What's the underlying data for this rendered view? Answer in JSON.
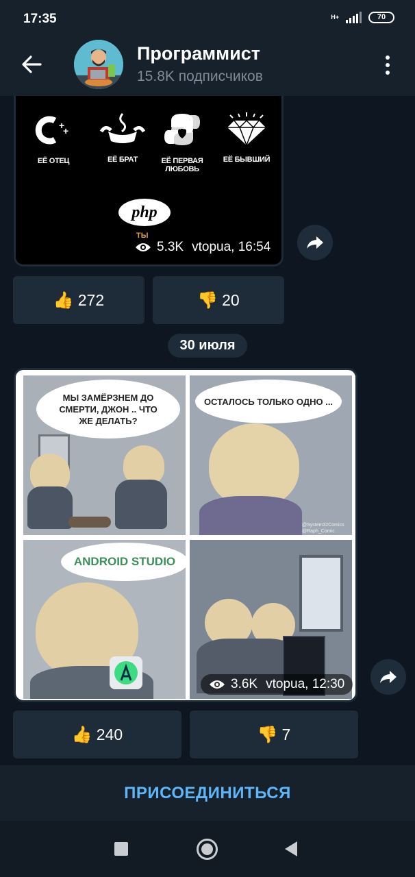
{
  "status_bar": {
    "time": "17:35",
    "network": "H+",
    "battery": "70"
  },
  "header": {
    "title": "Программист",
    "subtitle": "15.8K подписчиков"
  },
  "post1": {
    "languages": [
      {
        "icon": "cplusplus-icon",
        "label": "ЕЁ ОТЕЦ"
      },
      {
        "icon": "java-icon",
        "label": "ЕЁ БРАТ"
      },
      {
        "icon": "python-icon",
        "label": "ЕЁ ПЕРВАЯ ЛЮБОВЬ"
      },
      {
        "icon": "diamond-icon",
        "label": "ЕЁ БЫВШИЙ"
      }
    ],
    "php_logo": "php",
    "tag": "ТЫ",
    "views": "5.3K",
    "author_time": "vtopua, 16:54",
    "reactions": {
      "like": {
        "emoji": "👍",
        "count": "272"
      },
      "dislike": {
        "emoji": "👎",
        "count": "20"
      }
    }
  },
  "date_separator": "30 июля",
  "post2": {
    "bubble1": "МЫ ЗАМЁРЗНЕМ ДО СМЕРТИ, ДЖОН .. ЧТО ЖЕ ДЕЛАТЬ?",
    "bubble2": "ОСТАЛОСЬ ТОЛЬКО ОДНО ...",
    "bubble3": "ANDROID STUDIO",
    "credit": "@System32Comics @Raph_Comic",
    "views": "3.6K",
    "author_time": "vtopua, 12:30",
    "reactions": {
      "like": {
        "emoji": "👍",
        "count": "240"
      },
      "dislike": {
        "emoji": "👎",
        "count": "7"
      }
    }
  },
  "join_label": "ПРИСОЕДИНИТЬСЯ",
  "colors": {
    "background": "#0e1621",
    "header": "#17212b",
    "accent": "#5eb5f7",
    "reaction_bg": "#1e2b38"
  }
}
